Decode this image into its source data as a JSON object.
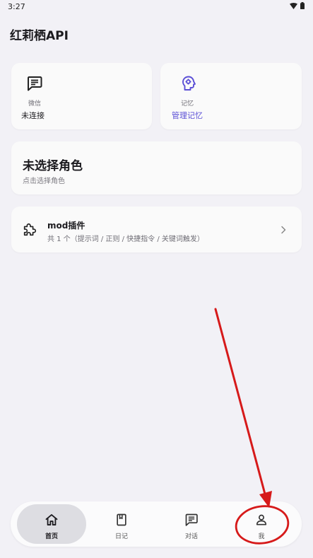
{
  "status_bar": {
    "time": "3:27",
    "icons": [
      "wifi-icon",
      "battery-icon"
    ]
  },
  "app": {
    "title": "红莉栖API"
  },
  "cards": {
    "wechat": {
      "icon": "chat-icon",
      "caption": "微信",
      "value": "未连接"
    },
    "memory": {
      "icon": "brain-gear-icon",
      "caption": "记忆",
      "value": "管理记忆",
      "accent": "#5b4fd6"
    },
    "role": {
      "title": "未选择角色",
      "subtitle": "点击选择角色"
    },
    "mod": {
      "icon": "puzzle-icon",
      "title": "mod插件",
      "subtitle": "共 1 个（提示词 / 正则 / 快捷指令 / 关键词触发）",
      "chevron": "chevron-right-icon"
    }
  },
  "nav": {
    "items": [
      {
        "label": "首页",
        "icon": "home-icon",
        "active": true
      },
      {
        "label": "日记",
        "icon": "book-icon",
        "active": false
      },
      {
        "label": "对话",
        "icon": "chat-icon",
        "active": false
      },
      {
        "label": "我",
        "icon": "person-icon",
        "active": false
      }
    ]
  },
  "annotation": {
    "color": "#d61a1a"
  }
}
